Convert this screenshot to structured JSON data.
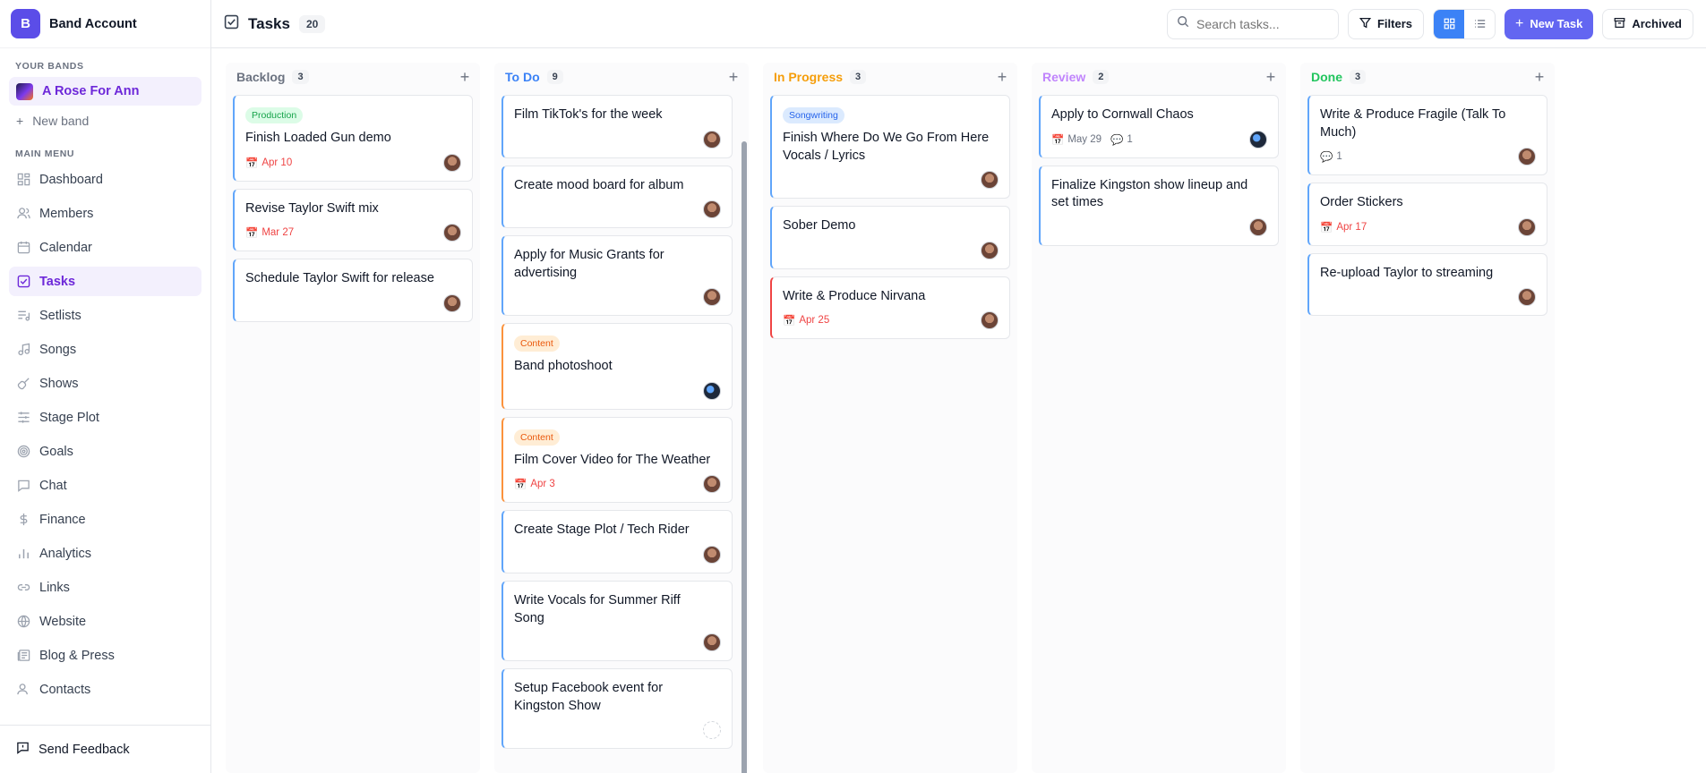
{
  "sidebar": {
    "brand_initial": "B",
    "brand_name": "Band Account",
    "your_bands_label": "YOUR BANDS",
    "active_band": "A Rose For Ann",
    "new_band_label": "New band",
    "main_menu_label": "MAIN MENU",
    "items": [
      {
        "label": "Dashboard",
        "icon": "dashboard-icon"
      },
      {
        "label": "Members",
        "icon": "members-icon"
      },
      {
        "label": "Calendar",
        "icon": "calendar-icon"
      },
      {
        "label": "Tasks",
        "icon": "tasks-icon",
        "active": true
      },
      {
        "label": "Setlists",
        "icon": "setlists-icon"
      },
      {
        "label": "Songs",
        "icon": "music-note-icon"
      },
      {
        "label": "Shows",
        "icon": "guitar-icon"
      },
      {
        "label": "Stage Plot",
        "icon": "sliders-icon"
      },
      {
        "label": "Goals",
        "icon": "target-icon"
      },
      {
        "label": "Chat",
        "icon": "chat-icon"
      },
      {
        "label": "Finance",
        "icon": "dollar-icon"
      },
      {
        "label": "Analytics",
        "icon": "bar-chart-icon"
      },
      {
        "label": "Links",
        "icon": "link-icon"
      },
      {
        "label": "Website",
        "icon": "globe-icon"
      },
      {
        "label": "Blog & Press",
        "icon": "newspaper-icon"
      },
      {
        "label": "Contacts",
        "icon": "contacts-icon"
      }
    ],
    "feedback_label": "Send Feedback"
  },
  "header": {
    "title": "Tasks",
    "count": "20",
    "search_placeholder": "Search tasks...",
    "filters_label": "Filters",
    "new_task_label": "New Task",
    "archived_label": "Archived"
  },
  "colors": {
    "brand": "#5b4de8",
    "backlog": "#6b7280",
    "todo": "#3b82f6",
    "in_progress": "#f59e0b",
    "review": "#c084fc",
    "done": "#22c55e"
  },
  "columns": [
    {
      "title": "Backlog",
      "count": "3",
      "cards": [
        {
          "tag": "Production",
          "title": "Finish Loaded Gun demo",
          "date": "Apr 10"
        },
        {
          "title": "Revise Taylor Swift mix",
          "date": "Mar 27"
        },
        {
          "title": "Schedule Taylor Swift for release"
        }
      ]
    },
    {
      "title": "To Do",
      "count": "9",
      "cards": [
        {
          "title": "Film TikTok's for the week"
        },
        {
          "title": "Create mood board for album"
        },
        {
          "title": "Apply for Music Grants for advertising"
        },
        {
          "tag": "Content",
          "title": "Band photoshoot"
        },
        {
          "tag": "Content",
          "title": "Film Cover Video for The Weather",
          "date": "Apr 3"
        },
        {
          "title": "Create Stage Plot / Tech Rider"
        },
        {
          "title": "Write Vocals for Summer Riff Song"
        },
        {
          "title": "Setup Facebook event for Kingston Show"
        }
      ]
    },
    {
      "title": "In Progress",
      "count": "3",
      "cards": [
        {
          "tag": "Songwriting",
          "title": "Finish Where Do We Go From Here Vocals / Lyrics"
        },
        {
          "title": "Sober Demo"
        },
        {
          "title": "Write & Produce Nirvana",
          "date": "Apr 25"
        }
      ]
    },
    {
      "title": "Review",
      "count": "2",
      "cards": [
        {
          "title": "Apply to Cornwall Chaos",
          "date": "May 29",
          "comments": "1"
        },
        {
          "title": "Finalize Kingston show lineup and set times"
        }
      ]
    },
    {
      "title": "Done",
      "count": "3",
      "cards": [
        {
          "title": "Write & Produce Fragile (Talk To Much)",
          "comments": "1"
        },
        {
          "title": "Order Stickers",
          "date": "Apr 17"
        },
        {
          "title": "Re-upload Taylor to streaming"
        }
      ]
    }
  ]
}
